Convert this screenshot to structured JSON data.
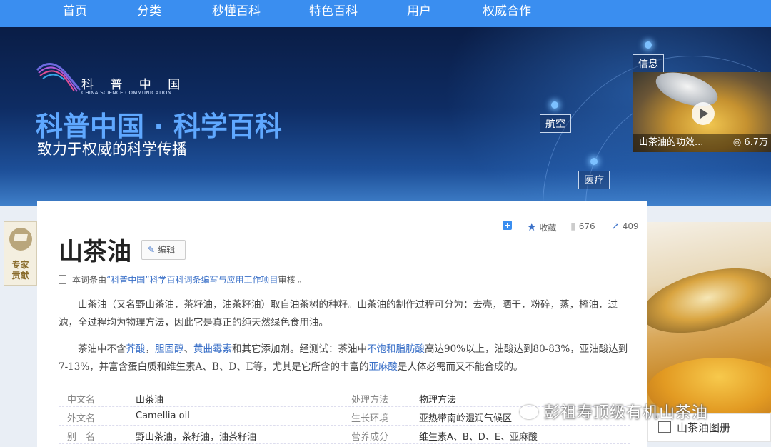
{
  "nav": {
    "items": [
      "首页",
      "分类",
      "秒懂百科",
      "特色百科",
      "用户",
      "权威合作"
    ]
  },
  "banner": {
    "logo_cn": "科 普 中 国",
    "logo_en": "CHINA SCIENCE COMMUNICATION",
    "title": "科普中国 · 科学百科",
    "subtitle": "致力于权威的科学传播",
    "tags": [
      "信息",
      "航空",
      "医疗"
    ],
    "video": {
      "caption": "山茶油的功效...",
      "views": "6.7万"
    }
  },
  "expert": {
    "label_line1": "专家",
    "label_line2": "贡献"
  },
  "actions": {
    "collect": "收藏",
    "likes": "676",
    "shares": "409"
  },
  "entry": {
    "title": "山茶油",
    "edit_label": "编辑",
    "review_prefix": "本词条由",
    "review_link": "“科普中国”科学百科词条编写与应用工作项目",
    "review_suffix": " 审核 。",
    "para1": "山茶油（又名野山茶油，茶籽油，油茶籽油）取自油茶树的种籽。山茶油的制作过程可分为：去壳，晒干，粉碎，蒸，榨油，过滤，全过程均为物理方法，因此它是真正的纯天然绿色食用油。",
    "para2_parts": [
      {
        "t": "茶油中不含",
        "link": false
      },
      {
        "t": "芥酸",
        "link": true
      },
      {
        "t": "，",
        "link": false
      },
      {
        "t": "胆固醇",
        "link": true
      },
      {
        "t": "、",
        "link": false
      },
      {
        "t": "黄曲霉素",
        "link": true
      },
      {
        "t": "和其它添加剂。经测试：茶油中",
        "link": false
      },
      {
        "t": "不饱和脂肪酸",
        "link": true
      },
      {
        "t": "高达90%以上，油酸达到80-83%，亚油酸达到7-13%，并富含蛋白质和维生素A、B、D、E等，尤其是它所含的丰富的",
        "link": false
      },
      {
        "t": "亚麻酸",
        "link": true
      },
      {
        "t": "是人体必需而又不能合成的。",
        "link": false
      }
    ]
  },
  "infobox": [
    {
      "k1": "中文名",
      "v1": "山茶油",
      "k2": "处理方法",
      "v2": "物理方法"
    },
    {
      "k1": "外文名",
      "v1": "Camellia oil",
      "k2": "生长环境",
      "v2": "亚热带南岭湿润气候区"
    },
    {
      "k1": "别　名",
      "v1": "野山茶油，茶籽油，油茶籽油",
      "k2": "营养成分",
      "v2": "维生素A、B、D、E、亚麻酸"
    }
  ],
  "album_label": "山茶油图册",
  "watermark": "彭祖寿顶级有机山茶油",
  "colors": {
    "nav": "#3a8ef0",
    "link": "#3a70c8",
    "banner_title": "#5fa8ff"
  }
}
